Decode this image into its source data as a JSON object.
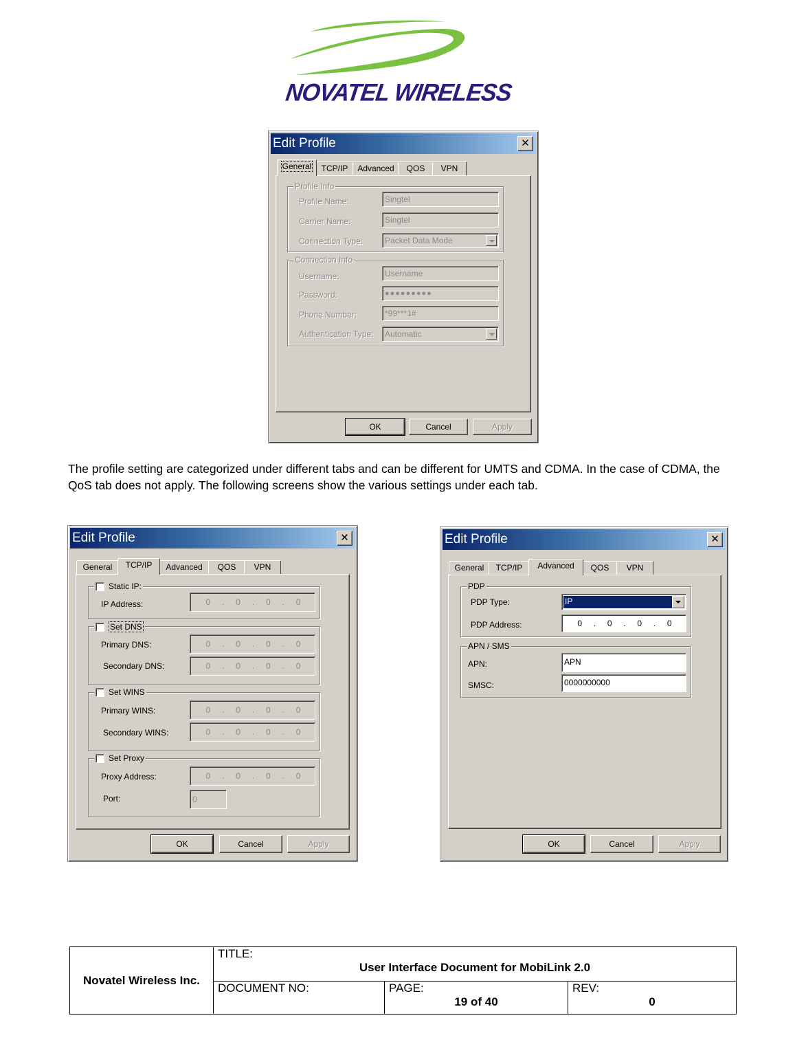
{
  "logo": {
    "text": "NOVATEL WIRELESS",
    "swoosh_color": "#7ac142",
    "text_color": "#2e1a7a"
  },
  "dialogs": {
    "general": {
      "title": "Edit Profile",
      "close_glyph": "✕",
      "tabs": [
        "General",
        "TCP/IP",
        "Advanced",
        "QOS",
        "VPN"
      ],
      "active_tab": "General",
      "profile_info": {
        "legend": "Profile Info",
        "profile_name_label": "Profile Name:",
        "profile_name_value": "Singtel",
        "carrier_name_label": "Carrier Name:",
        "carrier_name_value": "Singtel",
        "connection_type_label": "Connection Type:",
        "connection_type_value": "Packet Data Mode"
      },
      "connection_info": {
        "legend": "Connection Info",
        "username_label": "Username:",
        "username_value": "Username",
        "password_label": "Password:",
        "password_value": "●●●●●●●●●",
        "phone_label": "Phone Number:",
        "phone_value": "*99***1#",
        "auth_label": "Authentication Type:",
        "auth_value": "Automatic"
      },
      "buttons": {
        "ok": "OK",
        "cancel": "Cancel",
        "apply": "Apply"
      }
    },
    "tcpip": {
      "title": "Edit Profile",
      "close_glyph": "✕",
      "tabs": [
        "General",
        "TCP/IP",
        "Advanced",
        "QOS",
        "VPN"
      ],
      "active_tab": "TCP/IP",
      "static_ip": {
        "legend": "Static IP:",
        "checked": false,
        "ip_label": "IP Address:",
        "ip_value": [
          "0",
          "0",
          "0",
          "0"
        ]
      },
      "dns": {
        "legend": "Set DNS",
        "checked": false,
        "primary_label": "Primary DNS:",
        "primary_value": [
          "0",
          "0",
          "0",
          "0"
        ],
        "secondary_label": "Secondary DNS:",
        "secondary_value": [
          "0",
          "0",
          "0",
          "0"
        ]
      },
      "wins": {
        "legend": "Set WINS",
        "checked": false,
        "primary_label": "Primary WINS:",
        "primary_value": [
          "0",
          "0",
          "0",
          "0"
        ],
        "secondary_label": "Secondary WINS:",
        "secondary_value": [
          "0",
          "0",
          "0",
          "0"
        ]
      },
      "proxy": {
        "legend": "Set Proxy",
        "checked": false,
        "address_label": "Proxy Address:",
        "address_value": [
          "0",
          "0",
          "0",
          "0"
        ],
        "port_label": "Port:",
        "port_value": "0"
      },
      "buttons": {
        "ok": "OK",
        "cancel": "Cancel",
        "apply": "Apply"
      }
    },
    "advanced": {
      "title": "Edit Profile",
      "close_glyph": "✕",
      "tabs": [
        "General",
        "TCP/IP",
        "Advanced",
        "QOS",
        "VPN"
      ],
      "active_tab": "Advanced",
      "pdp": {
        "legend": "PDP",
        "type_label": "PDP Type:",
        "type_value": "IP",
        "address_label": "PDP Address:",
        "address_value": [
          "0",
          "0",
          "0",
          "0"
        ]
      },
      "apn_sms": {
        "legend": "APN / SMS",
        "apn_label": "APN:",
        "apn_value": "APN",
        "smsc_label": "SMSC:",
        "smsc_value": "0000000000"
      },
      "buttons": {
        "ok": "OK",
        "cancel": "Cancel",
        "apply": "Apply"
      }
    }
  },
  "body_text": "The profile setting are categorized under different tabs and can be different for UMTS and CDMA.  In the case of CDMA, the QoS tab does not apply.  The following screens show the various settings under each tab.",
  "footer": {
    "company": "Novatel Wireless Inc.",
    "title_label": "TITLE:",
    "title_value": "User Interface Document for MobiLink 2.0",
    "docno_label": "DOCUMENT NO:",
    "docno_value": "",
    "page_label": "PAGE:",
    "page_value": "19 of 40",
    "rev_label": "REV:",
    "rev_value": "0"
  }
}
